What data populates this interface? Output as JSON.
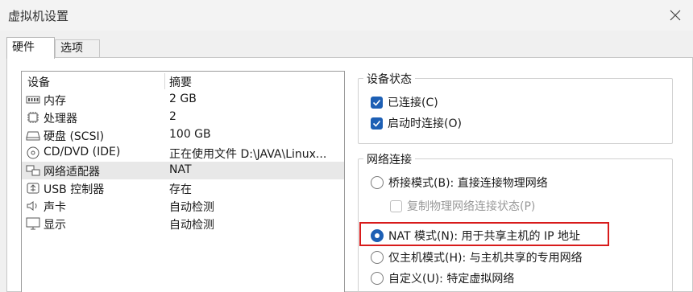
{
  "window": {
    "title": "虚拟机设置"
  },
  "tabs": [
    {
      "label": "硬件",
      "active": true
    },
    {
      "label": "选项",
      "active": false
    }
  ],
  "device_list": {
    "headers": {
      "device": "设备",
      "summary": "摘要"
    },
    "rows": [
      {
        "icon": "memory-icon",
        "name": "内存",
        "summary": "2 GB",
        "selected": false
      },
      {
        "icon": "processor-icon",
        "name": "处理器",
        "summary": "2",
        "selected": false
      },
      {
        "icon": "hard-disk-icon",
        "name": "硬盘 (SCSI)",
        "summary": "100 GB",
        "selected": false
      },
      {
        "icon": "cd-dvd-icon",
        "name": "CD/DVD (IDE)",
        "summary": "正在使用文件 D:\\JAVA\\Linux...",
        "selected": false
      },
      {
        "icon": "network-adapter-icon",
        "name": "网络适配器",
        "summary": "NAT",
        "selected": true
      },
      {
        "icon": "usb-icon",
        "name": "USB 控制器",
        "summary": "存在",
        "selected": false
      },
      {
        "icon": "sound-card-icon",
        "name": "声卡",
        "summary": "自动检测",
        "selected": false
      },
      {
        "icon": "display-icon",
        "name": "显示",
        "summary": "自动检测",
        "selected": false
      }
    ]
  },
  "device_status": {
    "title": "设备状态",
    "connected": {
      "label": "已连接(C)",
      "checked": true
    },
    "connect_at_power_on": {
      "label": "启动时连接(O)",
      "checked": true
    }
  },
  "network_connection": {
    "title": "网络连接",
    "bridged": {
      "label": "桥接模式(B): 直接连接物理网络",
      "selected": false
    },
    "replicate": {
      "label": "复制物理网络连接状态(P)",
      "checked": false,
      "enabled": false
    },
    "nat": {
      "label": "NAT 模式(N): 用于共享主机的 IP 地址",
      "selected": true
    },
    "host_only": {
      "label": "仅主机模式(H): 与主机共享的专用网络",
      "selected": false
    },
    "custom": {
      "label": "自定义(U): 特定虚拟网络",
      "selected": false
    }
  },
  "colors": {
    "accent": "#1d5fb4",
    "highlight": "#d81b1b",
    "selected_row": "#e8e8e8"
  }
}
